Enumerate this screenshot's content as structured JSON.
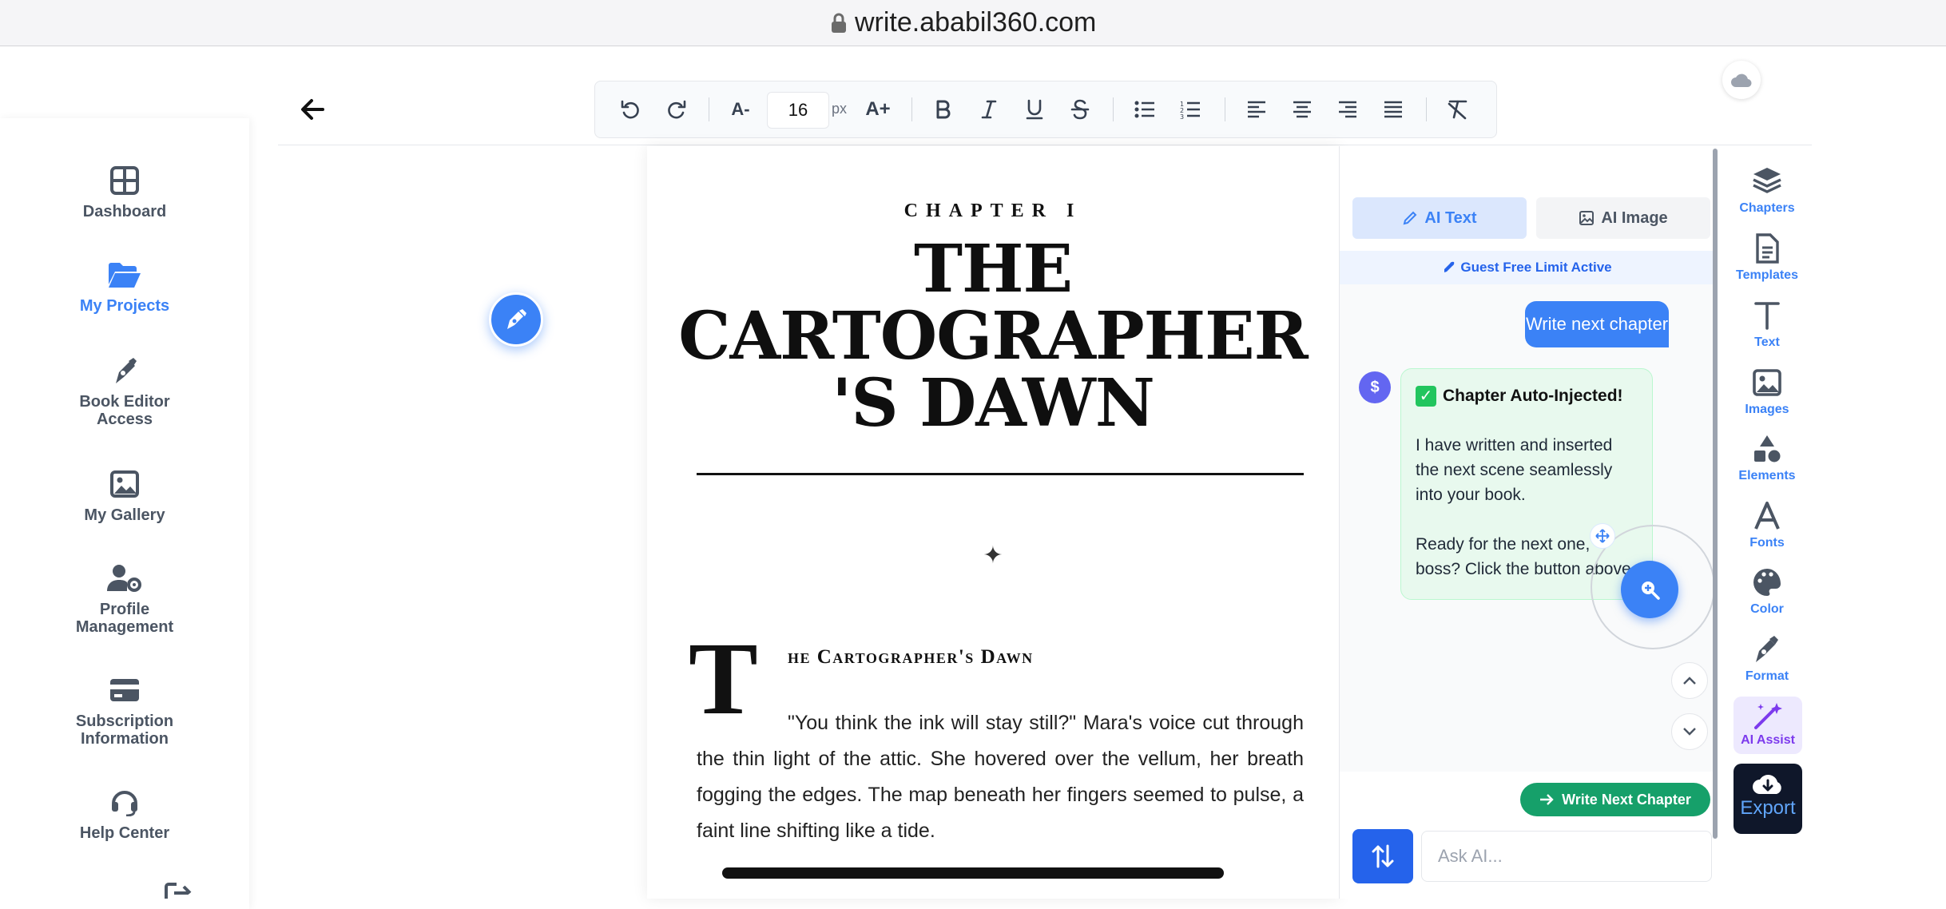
{
  "browser": {
    "url": "write.ababil360.com"
  },
  "sidebar": {
    "items": [
      {
        "label": "Dashboard",
        "icon": "grid-icon"
      },
      {
        "label": "My Projects",
        "icon": "folder-open-icon",
        "active": true
      },
      {
        "label": "Book Editor Access",
        "icon": "pen-nib-icon"
      },
      {
        "label": "My Gallery",
        "icon": "image-icon"
      },
      {
        "label": "Profile Management",
        "icon": "user-gear-icon"
      },
      {
        "label": "Subscription Information",
        "icon": "credit-card-icon"
      },
      {
        "label": "Help Center",
        "icon": "headset-icon"
      }
    ]
  },
  "toolbar": {
    "font_size_value": "16",
    "font_size_unit": "px",
    "decrease_label": "A-",
    "increase_label": "A+",
    "buttons": [
      "undo-icon",
      "redo-icon",
      "bold-icon",
      "italic-icon",
      "underline-icon",
      "strikethrough-icon",
      "bullet-list-icon",
      "numbered-list-icon",
      "align-left-icon",
      "align-center-icon",
      "align-right-icon",
      "align-justify-icon",
      "clear-format-icon"
    ]
  },
  "document": {
    "chapter_label": "CHAPTER I",
    "title_lines": [
      "THE",
      "CARTOGRAPHER",
      "'S DAWN"
    ],
    "ornament": "✦",
    "dropcap": "T",
    "scene_heading": "he Cartographer's Dawn",
    "body": "\"You think the ink will stay still?\" Mara's voice cut through the thin light of the attic. She hovered over the vellum, her breath fogging the edges. The map beneath her fingers seemed to pulse, a faint line shifting like a tide."
  },
  "ai_panel": {
    "tab_text": "AI Text",
    "tab_image": "AI Image",
    "limit_notice": "Guest Free Limit Active",
    "user_message": "Write next chapter",
    "bot_avatar": "$",
    "bot_title": "Chapter Auto-Injected!",
    "bot_para1": "I have written and inserted the next scene seamlessly into your book.",
    "bot_para2": "Ready for the next one, boss? Click the button above.",
    "write_next_button": "Write Next Chapter",
    "ask_placeholder": "Ask AI..."
  },
  "rail": {
    "items": [
      {
        "label": "Chapters",
        "icon": "layers-icon"
      },
      {
        "label": "Templates",
        "icon": "file-text-icon"
      },
      {
        "label": "Text",
        "icon": "text-t-icon"
      },
      {
        "label": "Images",
        "icon": "image-icon"
      },
      {
        "label": "Elements",
        "icon": "shapes-icon"
      },
      {
        "label": "Fonts",
        "icon": "font-a-icon"
      },
      {
        "label": "Color",
        "icon": "palette-icon"
      },
      {
        "label": "Format",
        "icon": "pen-nib-icon"
      }
    ],
    "ai_assist": "AI Assist",
    "export": "Export"
  },
  "colors": {
    "accent": "#3b82f6",
    "success": "#16a06a",
    "ai_purple": "#7c3aed",
    "dark": "#0f172a"
  }
}
